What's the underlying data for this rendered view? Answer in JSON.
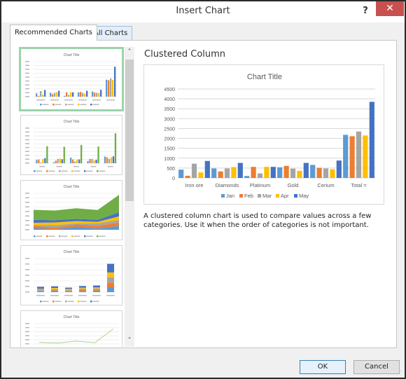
{
  "window": {
    "title": "Insert Chart",
    "help_label": "?",
    "close_label": "✕"
  },
  "tabs": [
    {
      "label": "Recommended Charts",
      "active": true
    },
    {
      "label": "All Charts",
      "active": false
    }
  ],
  "thumbnails": [
    {
      "name": "clustered-column",
      "title": "Chart Title",
      "selected": true
    },
    {
      "name": "clustered-column-by-month",
      "title": "Chart Title",
      "selected": false
    },
    {
      "name": "stacked-area",
      "title": "Chart Title",
      "selected": false
    },
    {
      "name": "stacked-column",
      "title": "Chart Title",
      "selected": false
    },
    {
      "name": "line",
      "title": "Chart Title",
      "selected": false
    }
  ],
  "scrollbar": {
    "up_icon": "˄",
    "down_icon": "˅"
  },
  "preview": {
    "heading": "Clustered Column",
    "description": "A clustered column chart is used to compare values across a few categories. Use it when the order of categories is not important."
  },
  "chart_data": {
    "type": "bar",
    "title": "Chart Title",
    "xlabel": "",
    "ylabel": "",
    "ylim": [
      0,
      4500
    ],
    "yticks": [
      0,
      500,
      1000,
      1500,
      2000,
      2500,
      3000,
      3500,
      4000,
      4500
    ],
    "ytick_labels": [
      "0",
      "500",
      "1000",
      "1500",
      "2000",
      "2500",
      "3000",
      "3500",
      "4000",
      "4500"
    ],
    "grid": true,
    "legend": "bottom",
    "categories": [
      "Iron ore",
      "Diamonds",
      "Platinum",
      "Gold",
      "Cerium",
      "Total ="
    ],
    "series": [
      {
        "name": "Jan",
        "color": "#5b9bd5",
        "values": [
          420,
          480,
          100,
          540,
          660,
          2180
        ]
      },
      {
        "name": "Feb",
        "color": "#ed7d31",
        "values": [
          110,
          330,
          560,
          610,
          510,
          2110
        ]
      },
      {
        "name": "Mar",
        "color": "#a5a5a5",
        "values": [
          720,
          480,
          230,
          470,
          480,
          2350
        ]
      },
      {
        "name": "Apr",
        "color": "#ffc000",
        "values": [
          280,
          550,
          560,
          360,
          440,
          2150
        ]
      },
      {
        "name": "May",
        "color": "#4472c4",
        "values": [
          860,
          760,
          560,
          760,
          880,
          3850
        ]
      }
    ]
  },
  "buttons": {
    "ok": "OK",
    "cancel": "Cancel"
  }
}
